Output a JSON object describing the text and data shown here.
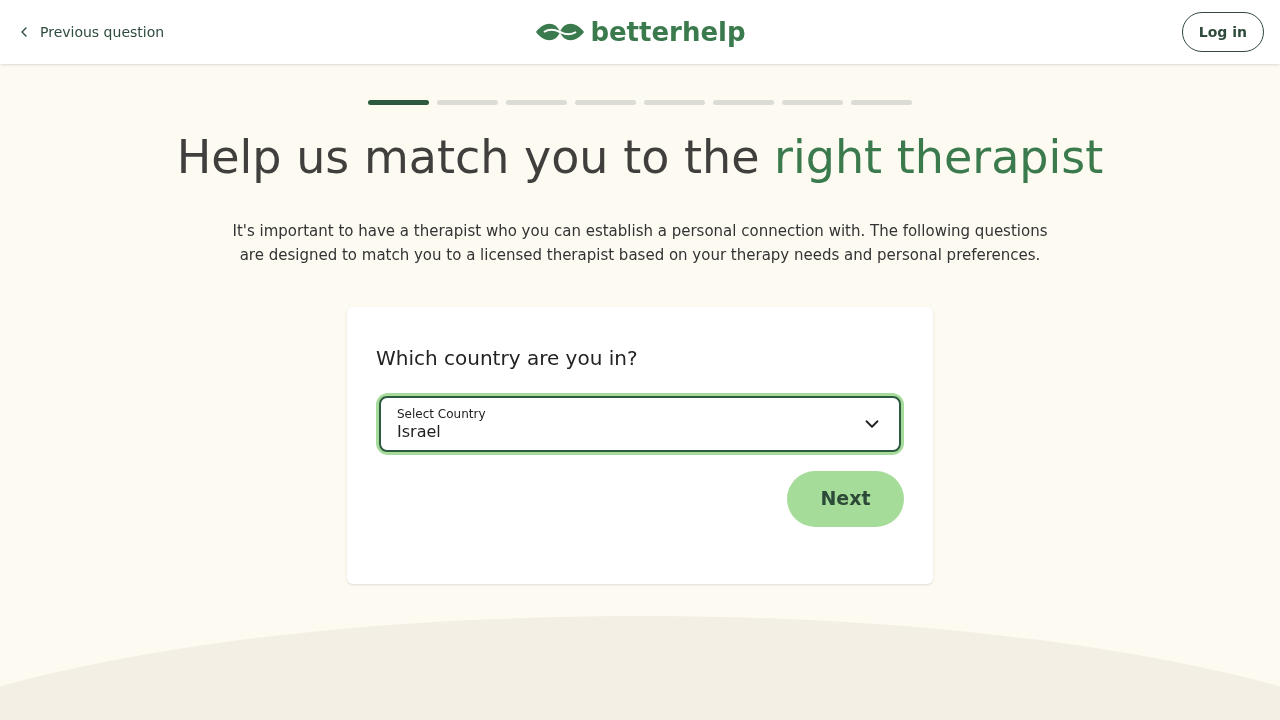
{
  "header": {
    "back_link": "Previous question",
    "logo": "betterhelp",
    "login_button": "Log in"
  },
  "progress": [
    {
      "done": true
    },
    {
      "done": false
    },
    {
      "done": false
    },
    {
      "done": false
    },
    {
      "done": false
    },
    {
      "done": false
    },
    {
      "done": false
    },
    {
      "done": false
    }
  ],
  "heading": {
    "text": "Help us match you to the ",
    "highlight": "right therapist"
  },
  "intro": "It's important to have a therapist who you can establish a personal connection with. The following questions are designed to match you to a licensed therapist based on your therapy needs and personal preferences.",
  "question": {
    "title": "Which country are you in?",
    "select": {
      "label": "Select Country",
      "value": "Israel"
    },
    "next_button": "Next"
  }
}
